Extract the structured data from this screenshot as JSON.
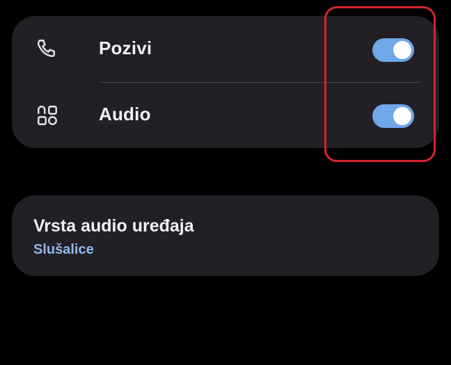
{
  "settings": {
    "rows": [
      {
        "label": "Pozivi",
        "icon": "phone-icon",
        "toggle_on": true
      },
      {
        "label": "Audio",
        "icon": "apps-icon",
        "toggle_on": true
      }
    ]
  },
  "audio_device": {
    "title": "Vrsta audio uređaja",
    "value": "Slušalice"
  },
  "colors": {
    "background": "#000000",
    "card": "#221f25",
    "toggle_on": "#6fa7e8",
    "accent_text": "#8fb8ec",
    "highlight": "#d8232c"
  }
}
